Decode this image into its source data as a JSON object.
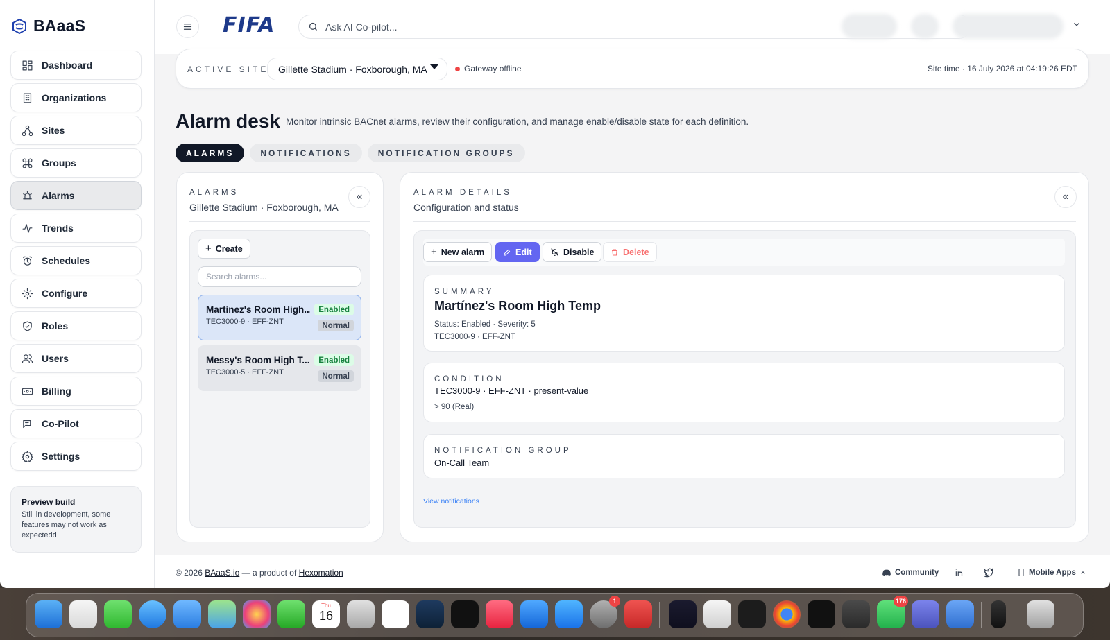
{
  "brand": {
    "name": "BAaaS",
    "accent": "#1e40af"
  },
  "topbar": {
    "logo": "FIFA",
    "search_placeholder": "Ask AI Co-pilot..."
  },
  "sidebar": {
    "items": [
      {
        "label": "Dashboard",
        "icon": "dashboard-icon"
      },
      {
        "label": "Organizations",
        "icon": "building-icon"
      },
      {
        "label": "Sites",
        "icon": "sites-icon"
      },
      {
        "label": "Groups",
        "icon": "command-icon"
      },
      {
        "label": "Alarms",
        "icon": "alarm-icon",
        "active": true
      },
      {
        "label": "Trends",
        "icon": "trend-icon"
      },
      {
        "label": "Schedules",
        "icon": "clock-icon"
      },
      {
        "label": "Configure",
        "icon": "gear-icon"
      },
      {
        "label": "Roles",
        "icon": "shield-icon"
      },
      {
        "label": "Users",
        "icon": "users-icon"
      },
      {
        "label": "Billing",
        "icon": "billing-icon"
      },
      {
        "label": "Co-Pilot",
        "icon": "copilot-icon"
      },
      {
        "label": "Settings",
        "icon": "settings-icon"
      }
    ],
    "preview": {
      "title": "Preview build",
      "text": "Still in development, some features may not work as expectedd"
    }
  },
  "site": {
    "label": "ACTIVE SITE",
    "selected": "Gillette Stadium · Foxborough, MA",
    "gateway_status": "Gateway offline",
    "site_time": "Site time · 16 July 2026 at 04:19:26 EDT"
  },
  "page": {
    "title": "Alarm desk",
    "description": "Monitor intrinsic BACnet alarms, review their configuration, and manage enable/disable state for each definition.",
    "tabs": [
      "ALARMS",
      "NOTIFICATIONS",
      "NOTIFICATION GROUPS"
    ]
  },
  "alarms_panel": {
    "label": "ALARMS",
    "subtitle": "Gillette Stadium · Foxborough, MA",
    "create_label": "Create",
    "search_placeholder": "Search alarms...",
    "items": [
      {
        "name": "Martínez's Room High...",
        "device": "TEC3000-9 · EFF-ZNT",
        "status": "Enabled",
        "state": "Normal"
      },
      {
        "name": "Messy's Room High T...",
        "device": "TEC3000-5 · EFF-ZNT",
        "status": "Enabled",
        "state": "Normal"
      }
    ]
  },
  "details": {
    "label": "ALARM DETAILS",
    "subtitle": "Configuration and status",
    "actions": {
      "new": "New alarm",
      "edit": "Edit",
      "disable": "Disable",
      "delete": "Delete"
    },
    "summary": {
      "label": "SUMMARY",
      "title": "Martínez's Room High Temp",
      "status_line": "Status: Enabled · Severity: 5",
      "device_line": "TEC3000-9 · EFF-ZNT"
    },
    "condition": {
      "label": "CONDITION",
      "property": "TEC3000-9 · EFF-ZNT · present-value",
      "threshold": "> 90 (Real)"
    },
    "notification_group": {
      "label": "NOTIFICATION GROUP",
      "value": "On-Call Team"
    },
    "view_link": "View notifications"
  },
  "footer": {
    "copyright_prefix": "© 2026",
    "site_link": "BAaaS.io",
    "middle": "— a product of",
    "company_link": "Hexomation",
    "community": "Community",
    "mobile_apps": "Mobile Apps"
  },
  "dock": {
    "calendar_month": "Thu",
    "calendar_day": "16",
    "badges": {
      "settings": "1",
      "whatsapp": "176"
    }
  }
}
